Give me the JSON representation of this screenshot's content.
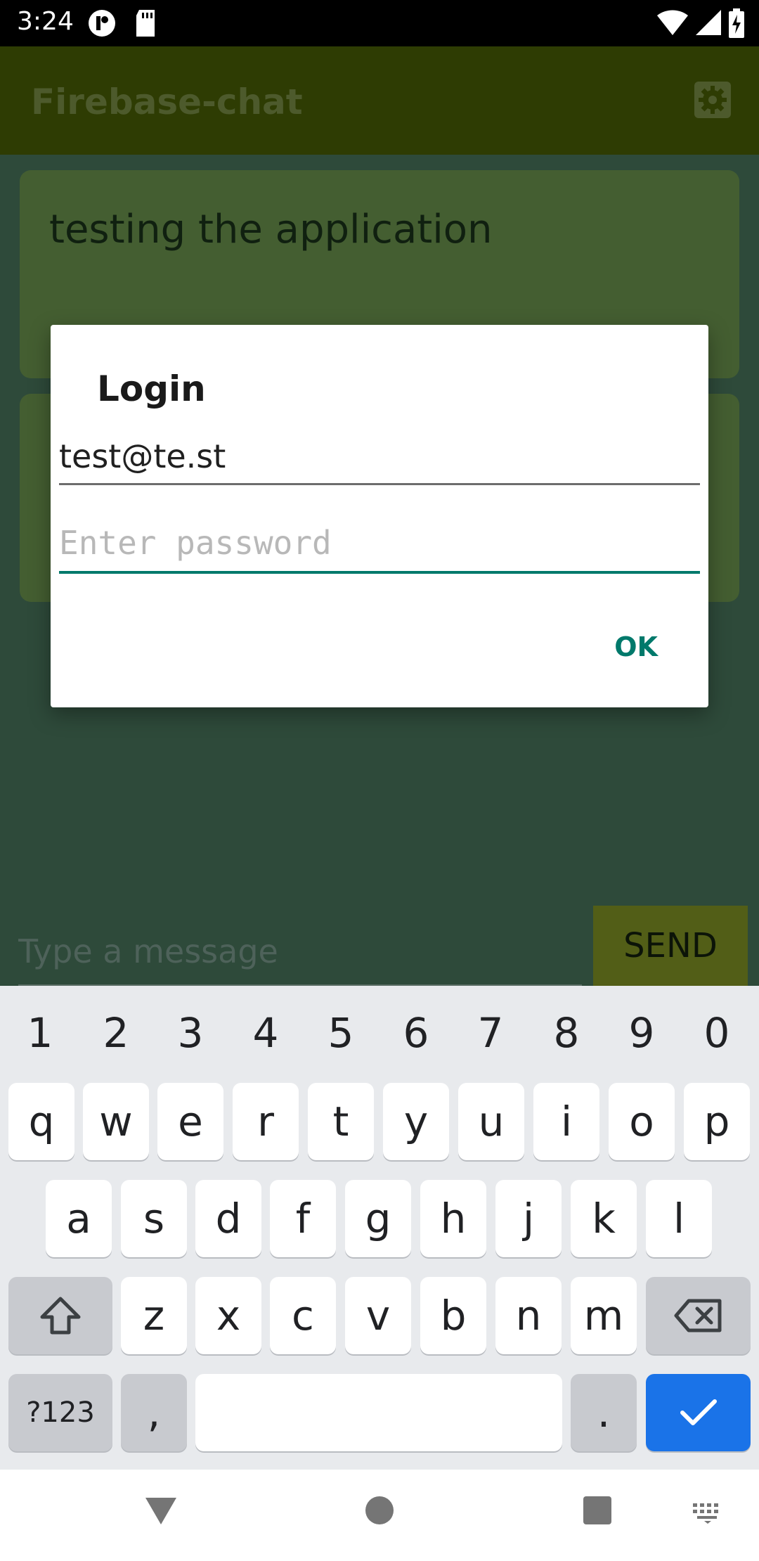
{
  "status_bar": {
    "time": "3:24",
    "icons": [
      "notification-icon",
      "sd-card-icon",
      "wifi-icon",
      "signal-icon",
      "battery-icon"
    ]
  },
  "app_bar": {
    "title": "Firebase-chat",
    "settings_icon": "gear-icon"
  },
  "messages": [
    {
      "text": "testing the application",
      "meta": ""
    },
    {
      "text": "",
      "meta": ""
    }
  ],
  "compose": {
    "placeholder": "Type a message",
    "send_label": "SEND"
  },
  "dialog": {
    "title": "Login",
    "email_value": "test@te.st",
    "password_placeholder": "Enter password",
    "ok_label": "OK"
  },
  "keyboard": {
    "numbers": [
      "1",
      "2",
      "3",
      "4",
      "5",
      "6",
      "7",
      "8",
      "9",
      "0"
    ],
    "row1": [
      "q",
      "w",
      "e",
      "r",
      "t",
      "y",
      "u",
      "i",
      "o",
      "p"
    ],
    "row2": [
      "a",
      "s",
      "d",
      "f",
      "g",
      "h",
      "j",
      "k",
      "l"
    ],
    "row3": [
      "z",
      "x",
      "c",
      "v",
      "b",
      "n",
      "m"
    ],
    "symbols_label": "?123",
    "comma": ",",
    "period": "."
  },
  "colors": {
    "app_bar": "#2e3c03",
    "content_bg": "#2e4a3a",
    "card": "#445e31",
    "accent": "#00796b",
    "enter_key": "#1a73e8"
  }
}
